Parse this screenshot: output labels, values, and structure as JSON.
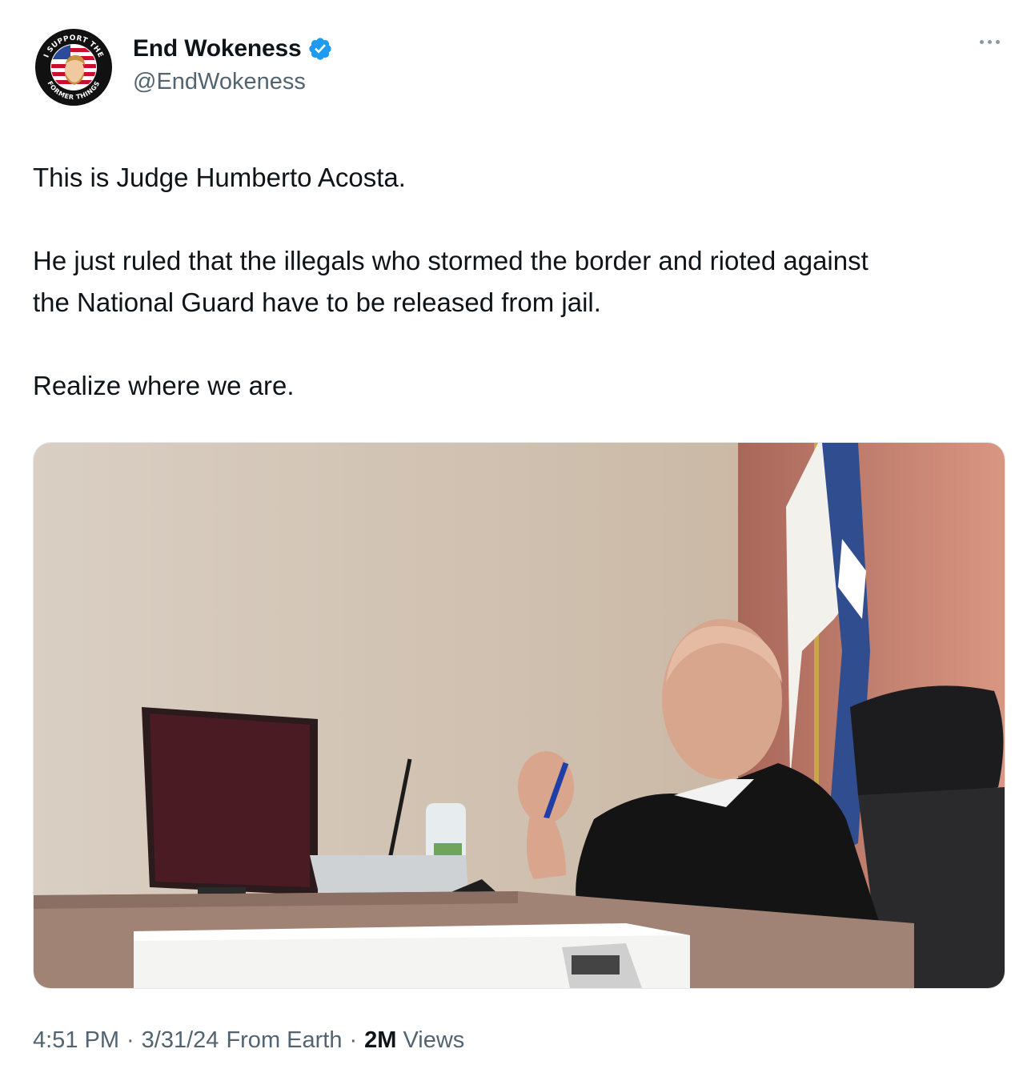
{
  "author": {
    "display_name": "End Wokeness",
    "handle": "@EndWokeness",
    "verified": true,
    "avatar_icon": "i-support-the-former-thing-badge",
    "avatar_text_top": "I SUPPORT THE",
    "avatar_text_bottom": "FORMER THING"
  },
  "tweet": {
    "paragraphs": [
      "This is Judge Humberto Acosta.",
      "He just ruled that the illegals who stormed the border and rioted against\nthe National Guard have to be released from jail.",
      "Realize where we are."
    ]
  },
  "meta": {
    "time": "4:51 PM",
    "date": "3/31/24",
    "source": "From Earth",
    "views_count": "2M",
    "views_label": "Views"
  },
  "icons": {
    "more": "more-horizontal-icon",
    "verified": "verified-badge-icon"
  },
  "colors": {
    "verified_blue": "#1d9bf0",
    "secondary_text": "#536471",
    "primary_text": "#0f1419"
  }
}
